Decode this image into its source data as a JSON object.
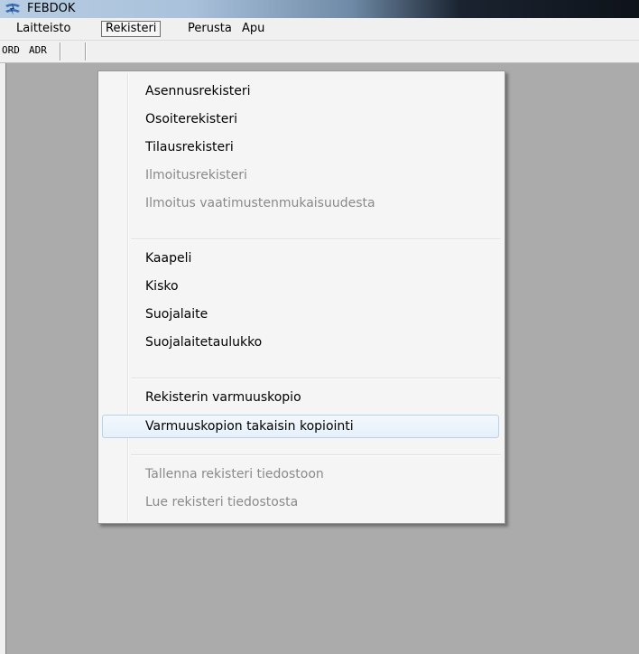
{
  "window": {
    "title": "FEBDOK",
    "icon": "febdok-logo-icon"
  },
  "menubar": {
    "items": [
      {
        "label": "Laitteisto"
      },
      {
        "label": "Rekisteri"
      },
      {
        "label": "Perusta"
      },
      {
        "label": "Apu"
      }
    ]
  },
  "toolbar": {
    "buttons": [
      {
        "label": "ORD"
      },
      {
        "label": "ADR"
      }
    ]
  },
  "dropdown": {
    "items": [
      {
        "label": "Asennusrekisteri",
        "enabled": true
      },
      {
        "label": "Osoiterekisteri",
        "enabled": true
      },
      {
        "label": "Tilausrekisteri",
        "enabled": true
      },
      {
        "label": "Ilmoitusrekisteri",
        "enabled": false
      },
      {
        "label": "Ilmoitus vaatimustenmukaisuudesta",
        "enabled": false
      },
      {
        "label": "Kaapeli",
        "enabled": true
      },
      {
        "label": "Kisko",
        "enabled": true
      },
      {
        "label": "Suojalaite",
        "enabled": true
      },
      {
        "label": "Suojalaitetaulukko",
        "enabled": true
      },
      {
        "label": "Rekisterin varmuuskopio",
        "enabled": true
      },
      {
        "label": "Varmuuskopion takaisin kopiointi",
        "enabled": true,
        "highlighted": true
      },
      {
        "label": "Tallenna rekisteri tiedostoon",
        "enabled": false
      },
      {
        "label": "Lue rekisteri tiedostosta",
        "enabled": false
      }
    ]
  },
  "colors": {
    "workspace": "#ababab",
    "highlight_border": "#b8d2ea",
    "disabled_text": "#8a8a8a"
  }
}
